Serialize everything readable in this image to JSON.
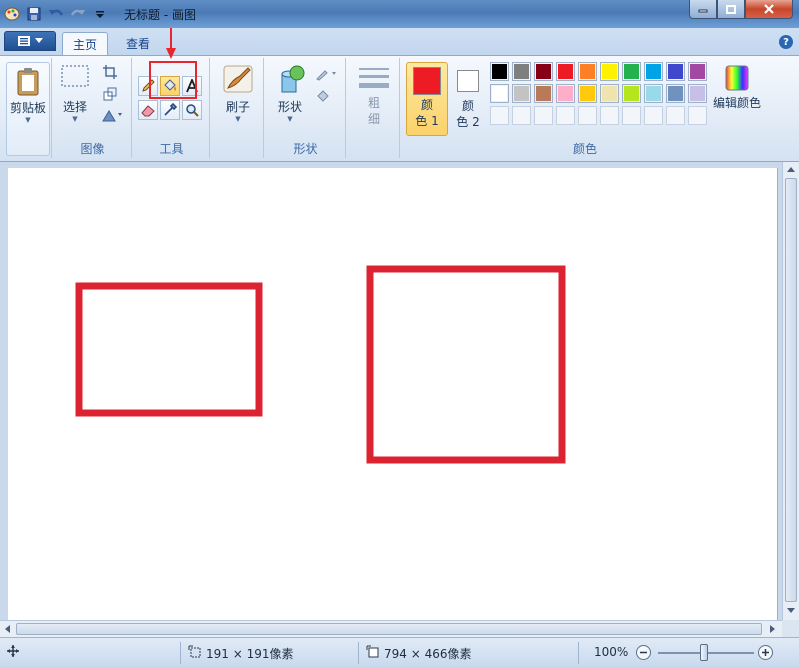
{
  "window": {
    "title": "无标题 - 画图"
  },
  "tabs": {
    "home": "主页",
    "view": "查看"
  },
  "ribbon": {
    "clipboard": {
      "label": "剪贴板"
    },
    "image": {
      "group_label": "图像",
      "select_label": "选择"
    },
    "tools": {
      "group_label": "工具"
    },
    "brushes": {
      "label": "刷子"
    },
    "shapes": {
      "group_label": "形状",
      "shapes_label": "形状"
    },
    "size": {
      "label_line1": "粗",
      "label_line2": "细"
    },
    "colors": {
      "group_label": "颜色",
      "color1_line1": "颜",
      "color1_line2": "色 1",
      "color2_line1": "颜",
      "color2_line2": "色 2",
      "edit_colors": "编辑颜色",
      "color1_value": "#ed1c24",
      "color2_value": "#ffffff",
      "palette_row1": [
        "#000000",
        "#7f7f7f",
        "#880015",
        "#ed1c24",
        "#ff7f27",
        "#fff200",
        "#22b14c",
        "#00a2e8",
        "#3f48cc",
        "#a349a4"
      ],
      "palette_row2": [
        "#ffffff",
        "#c3c3c3",
        "#b97a57",
        "#ffaec9",
        "#ffc90e",
        "#efe4b0",
        "#b5e61d",
        "#99d9ea",
        "#7092be",
        "#c8bfe7"
      ],
      "palette_row3": [
        "",
        "",
        "",
        "",
        "",
        "",
        "",
        "",
        "",
        ""
      ]
    },
    "selected_tool": "fill-bucket"
  },
  "canvas": {
    "stroke_color": "#dc2331"
  },
  "status": {
    "selection_size": "191 × 191像素",
    "canvas_size": "794 × 466像素",
    "zoom": "100%"
  }
}
